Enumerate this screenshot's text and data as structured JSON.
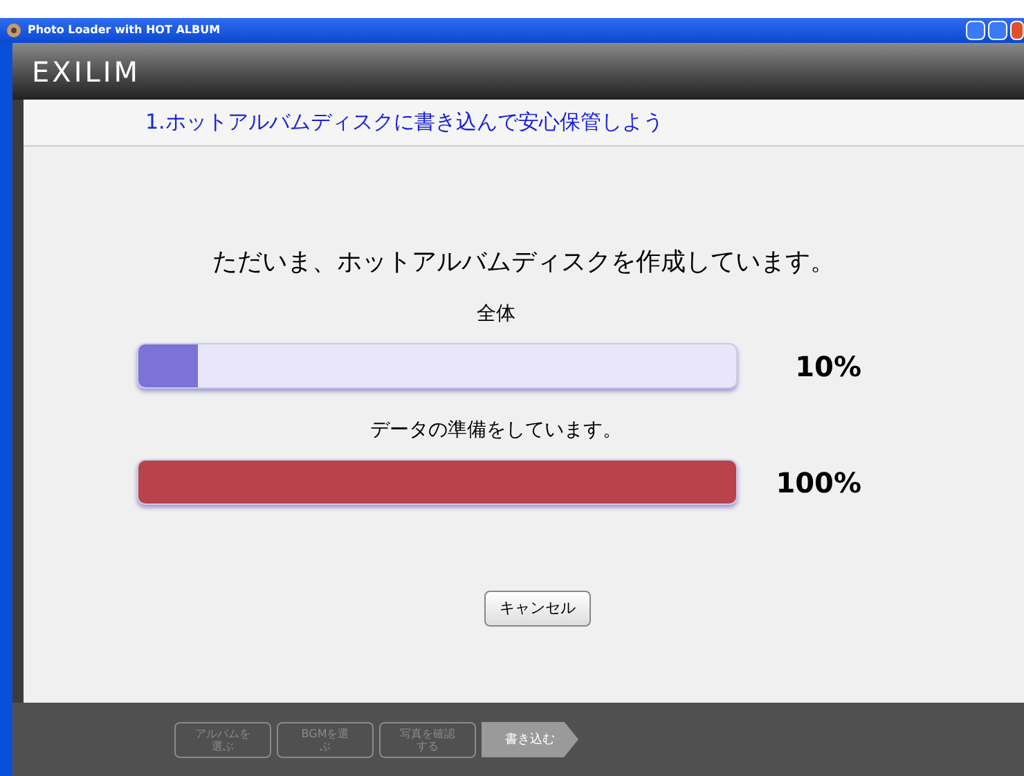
{
  "window": {
    "title": "Photo Loader with HOT ALBUM"
  },
  "logo": "EXILIM",
  "panel_title": "1.ホットアルバムディスクに書き込んで安心保管しよう",
  "message": "ただいま、ホットアルバムディスクを作成しています。",
  "progress": [
    {
      "label": "全体",
      "level": 0.1,
      "reading": "10%",
      "color": "#7b73d6"
    },
    {
      "label": "データの準備をしています。",
      "level": 1.0,
      "reading": "100%",
      "color": "#b8434a"
    }
  ],
  "buttons": [
    "キャンセル"
  ],
  "steps": [
    {
      "label": "アルバムを選ぶ",
      "selected": false
    },
    {
      "label": "BGMを選ぶ",
      "selected": false
    },
    {
      "label": "写真を確認する",
      "selected": false
    },
    {
      "label": "書き込む",
      "selected": true
    }
  ]
}
